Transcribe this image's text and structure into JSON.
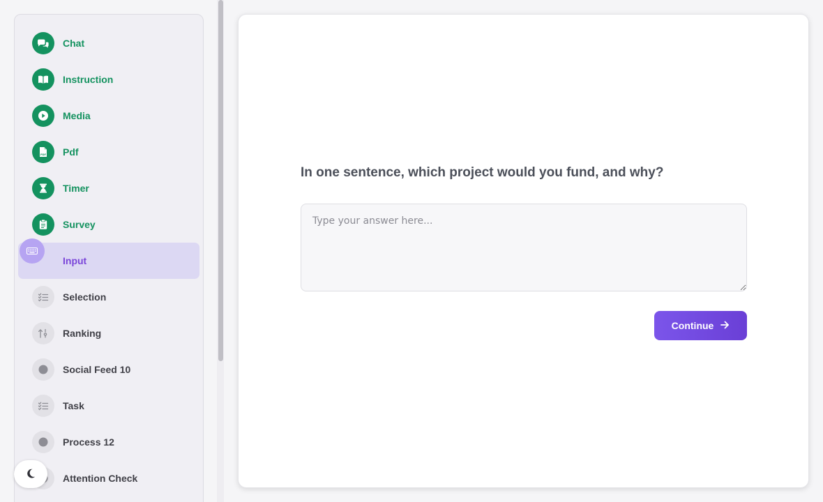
{
  "sidebar": {
    "items": [
      {
        "label": "Chat",
        "icon": "chat-bubbles-icon",
        "status": "done"
      },
      {
        "label": "Instruction",
        "icon": "book-icon",
        "status": "done"
      },
      {
        "label": "Media",
        "icon": "play-icon",
        "status": "done"
      },
      {
        "label": "Pdf",
        "icon": "pdf-file-icon",
        "status": "done"
      },
      {
        "label": "Timer",
        "icon": "hourglass-icon",
        "status": "done"
      },
      {
        "label": "Survey",
        "icon": "clipboard-icon",
        "status": "done"
      },
      {
        "label": "Input",
        "icon": "keyboard-icon",
        "status": "active"
      },
      {
        "label": "Selection",
        "icon": "checklist-icon",
        "status": "todo"
      },
      {
        "label": "Ranking",
        "icon": "sort-arrows-icon",
        "status": "todo"
      },
      {
        "label": "Social Feed 10",
        "icon": "dot-icon",
        "status": "todo"
      },
      {
        "label": "Task",
        "icon": "checklist-icon",
        "status": "todo"
      },
      {
        "label": "Process 12",
        "icon": "dot-icon",
        "status": "todo"
      },
      {
        "label": "Attention Check",
        "icon": "dot-icon",
        "status": "todo"
      }
    ],
    "theme_toggle_icon": "moon-icon"
  },
  "main": {
    "question": "In one sentence, which project would you fund, and why?",
    "answer_placeholder": "Type your answer here...",
    "answer_value": "",
    "continue_label": "Continue"
  },
  "colors": {
    "done": "#14925f",
    "active_bg": "#dcd8f3",
    "active_text": "#7a45d9",
    "button": "#7b55ea"
  }
}
